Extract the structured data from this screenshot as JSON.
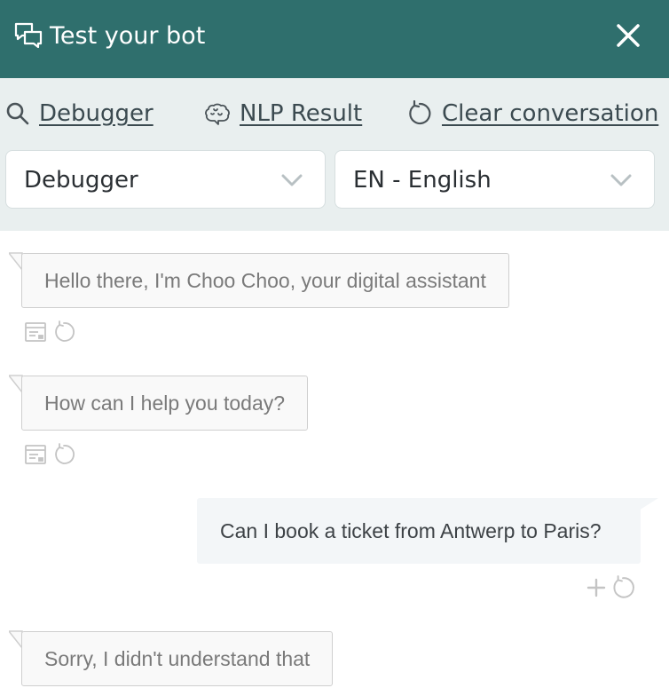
{
  "header": {
    "title": "Test your bot",
    "background": "#2f6f6d"
  },
  "toolbar": {
    "debugger_link": "Debugger",
    "nlp_link": "NLP Result",
    "clear_link": "Clear conversation",
    "mode_select": {
      "value": "Debugger"
    },
    "language_select": {
      "value": "EN - English"
    }
  },
  "messages": [
    {
      "from": "bot",
      "text": "Hello there, I'm Choo Choo, your digital assistant"
    },
    {
      "from": "bot",
      "text": "How can I help you today?"
    },
    {
      "from": "user",
      "text": "Can I book a ticket from Antwerp to Paris?"
    },
    {
      "from": "bot",
      "text": "Sorry, I didn't understand that"
    }
  ],
  "icons": {
    "chat": "chat-bubbles-icon",
    "close": "close-icon",
    "search": "search-icon",
    "brain": "brain-icon",
    "refresh": "refresh-icon",
    "payload": "payload-icon",
    "plus": "plus-icon"
  }
}
